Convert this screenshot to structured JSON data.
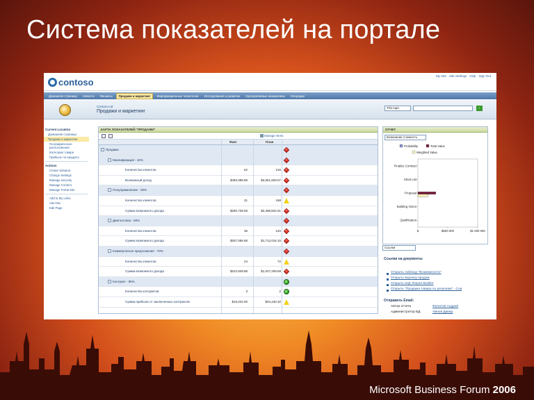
{
  "slide": {
    "title": "Система показателей на портале",
    "footer_brand": "Microsoft Business Forum",
    "footer_year": "2006"
  },
  "site": {
    "logo_text": "contoso",
    "top_links": [
      "My Site",
      "Site Settings",
      "Help",
      "Sign Out"
    ],
    "nav_tabs": [
      "Домашняя страница",
      "Новости",
      "Финансы",
      "Продажи и маркетинг",
      "Информационные технологии",
      "Исследования и развитие",
      "Корпоративные инициативы",
      "Операции"
    ],
    "active_tab_index": 3,
    "crumb_small": "Contoso Ltd",
    "site_title": "Продажи и маркетинг",
    "search_scope": "This topic"
  },
  "quicklaunch": {
    "heading": "Current Location",
    "items": [
      "Домашняя страница",
      "Продажи и маркетинг"
    ],
    "selected_index": 1,
    "extra": [
      "Географическое расположение",
      "Категория товара",
      "Прибыль по продукту"
    ],
    "actions_heading": "Actions",
    "actions": [
      "Create Subarea",
      "Change Settings",
      "Manage Security",
      "Manage Content",
      "Manage Portal Site"
    ],
    "more": [
      "Add to My Links",
      "Alert Me",
      "Edit Page"
    ]
  },
  "scorecard": {
    "title": "КАРТА ПОКАЗАТЕЛЕЙ \"ПРОДАЖИ\"",
    "manage_alerts": "Manage Alerts",
    "col_fact": "Факт",
    "col_plan": "План",
    "rows": [
      {
        "label": "Продажи",
        "level": 0,
        "fact": "",
        "plan": "",
        "status": "red"
      },
      {
        "label": "Квалификация - 10%",
        "level": 1,
        "fact": "",
        "plan": "",
        "status": "red"
      },
      {
        "label": "Количество клиентов",
        "level": 2,
        "fact": "62",
        "plan": "216",
        "status": "red"
      },
      {
        "label": "Возможный доход",
        "level": 2,
        "fact": "$493,389.89",
        "plan": "$3,801,829.07",
        "status": "red"
      },
      {
        "label": "Полуприменение - 30%",
        "level": 1,
        "fact": "",
        "plan": "",
        "status": "red"
      },
      {
        "label": "Количество клиентов",
        "level": 2,
        "fact": "31",
        "plan": "168",
        "status": "yellow"
      },
      {
        "label": "Сумма возможного дохода",
        "level": 2,
        "fact": "$280,728.58",
        "plan": "$2,398,822.61",
        "status": "red"
      },
      {
        "label": "Диагностика - 50%",
        "level": 1,
        "fact": "",
        "plan": "",
        "status": "red"
      },
      {
        "label": "Количество клиентов",
        "level": 2,
        "fact": "35",
        "plan": "120",
        "status": "red"
      },
      {
        "label": "Сумма возможного дохода",
        "level": 2,
        "fact": "$257,065.68",
        "plan": "$1,712,016.15",
        "status": "red"
      },
      {
        "label": "Коммерческое предложение - 70%",
        "level": 1,
        "fact": "",
        "plan": "",
        "status": "red"
      },
      {
        "label": "Количество клиентов",
        "level": 2,
        "fact": "24",
        "plan": "72",
        "status": "yellow"
      },
      {
        "label": "Сумма возможного дохода",
        "level": 2,
        "fact": "$223,929.88",
        "plan": "$1,027,209.69",
        "status": "red"
      },
      {
        "label": "Контракт - 95%",
        "level": 1,
        "fact": "",
        "plan": "",
        "status": "green"
      },
      {
        "label": "Количество контрактов",
        "level": 2,
        "fact": "3",
        "plan": "2",
        "status": "green"
      },
      {
        "label": "Сумма прибыли от заключенных контрактов",
        "level": 2,
        "fact": "$15,024.00",
        "plan": "$34,240.32",
        "status": "yellow"
      }
    ]
  },
  "report": {
    "title": "ОТЧЕТ",
    "selector": "Возможная стоимость",
    "legend": [
      "Probability",
      "Total Value",
      "Weighted Value"
    ],
    "x_ticks": [
      "$",
      "$500 000",
      "$1 000 000"
    ]
  },
  "chart_data": {
    "type": "bar",
    "orientation": "horizontal",
    "categories": [
      "Finalize Contract",
      "Short List",
      "Proposal",
      "Building Vision",
      "Qualification"
    ],
    "series": [
      {
        "name": "Probability",
        "values": [
          0,
          0,
          0,
          0,
          0
        ],
        "color": "#8a8ccf"
      },
      {
        "name": "Total Value",
        "values": [
          0,
          0,
          300000,
          0,
          0
        ],
        "color": "#7a1f3d"
      },
      {
        "name": "Weighted Value",
        "values": [
          0,
          0,
          170000,
          0,
          0
        ],
        "color": "#fbf6b8"
      }
    ],
    "xlim": [
      0,
      1000000
    ],
    "x_ticks": [
      "$",
      "$500 000",
      "$1 000 000"
    ]
  },
  "links": {
    "selector": "Ссылки",
    "title": "Ссылки на документы",
    "items": [
      "Открыть таблицу \"Возможности\"",
      "Открыть воронку продаж",
      "Открыть SQL Report Builder",
      "Открыть \"Продажа товара по регионам\" - Сов"
    ]
  },
  "email": {
    "title": "Отправить Email:",
    "rows": [
      {
        "role": "Автор отчета",
        "name": "Филатов Андрей"
      },
      {
        "role": "Администратор БД",
        "name": "Умнов Давид"
      }
    ]
  },
  "colors": {
    "accent": "#2b5f99",
    "nav_active": "#fbe9a4",
    "status_red": "#c81a0e",
    "status_yellow": "#f3d21e",
    "status_green": "#2a9a1e"
  }
}
